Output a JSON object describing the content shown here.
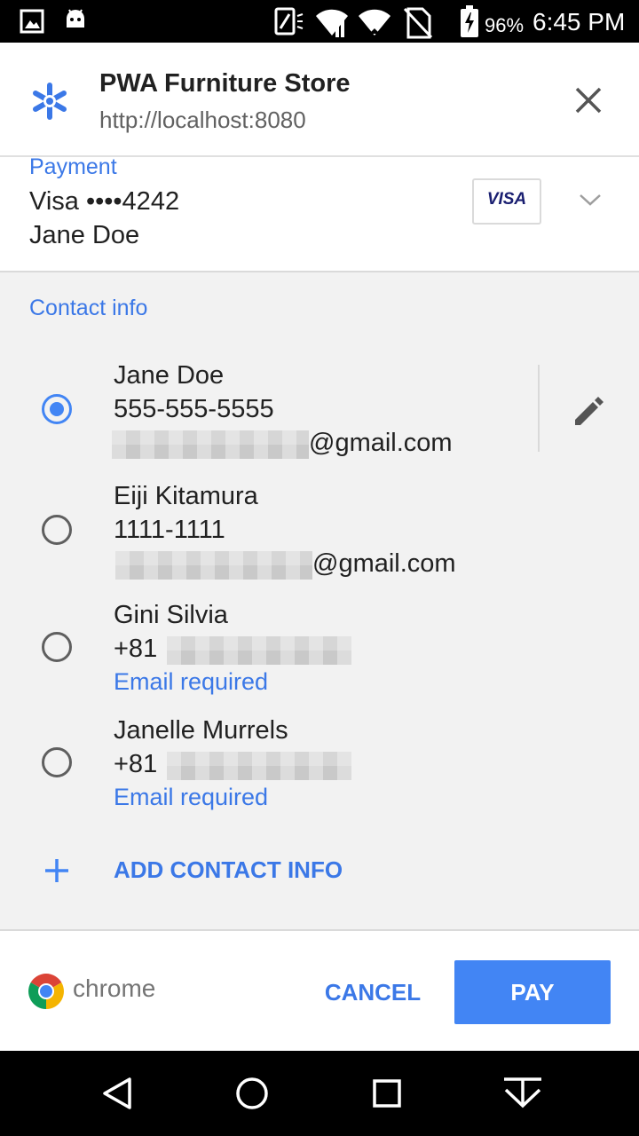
{
  "status_bar": {
    "battery": "96%",
    "time": "6:45 PM",
    "icons": [
      "gallery-icon",
      "android-icon",
      "nfc-icon",
      "wifi-calling-icon",
      "wifi-icon",
      "no-sim-icon",
      "battery-charging-icon"
    ]
  },
  "header": {
    "title": "PWA Furniture Store",
    "url": "http://localhost:8080",
    "icon": "store-icon",
    "close_icon": "close-icon"
  },
  "payment": {
    "label": "Payment",
    "card": "Visa  ••••4242",
    "name": "Jane Doe",
    "card_brand": "VISA"
  },
  "contact": {
    "label": "Contact info",
    "items": [
      {
        "name": "Jane Doe",
        "phone": "555-555-5555",
        "email_suffix": "@gmail.com",
        "selected": true
      },
      {
        "name": "Eiji Kitamura",
        "phone": "1111-1111",
        "email_suffix": "@gmail.com",
        "selected": false
      },
      {
        "name": "Gini Silvia",
        "phone": "+81",
        "note": "Email required",
        "selected": false
      },
      {
        "name": "Janelle Murrels",
        "phone": "+81",
        "note": "Email required",
        "selected": false
      }
    ],
    "add_label": "ADD CONTACT INFO"
  },
  "footer": {
    "brand": "chrome",
    "cancel": "CANCEL",
    "pay": "PAY"
  },
  "colors": {
    "accent": "#4285f4",
    "link": "#3b78e7",
    "section_bg": "#f2f2f2",
    "visa_blue": "#1a1f71"
  }
}
